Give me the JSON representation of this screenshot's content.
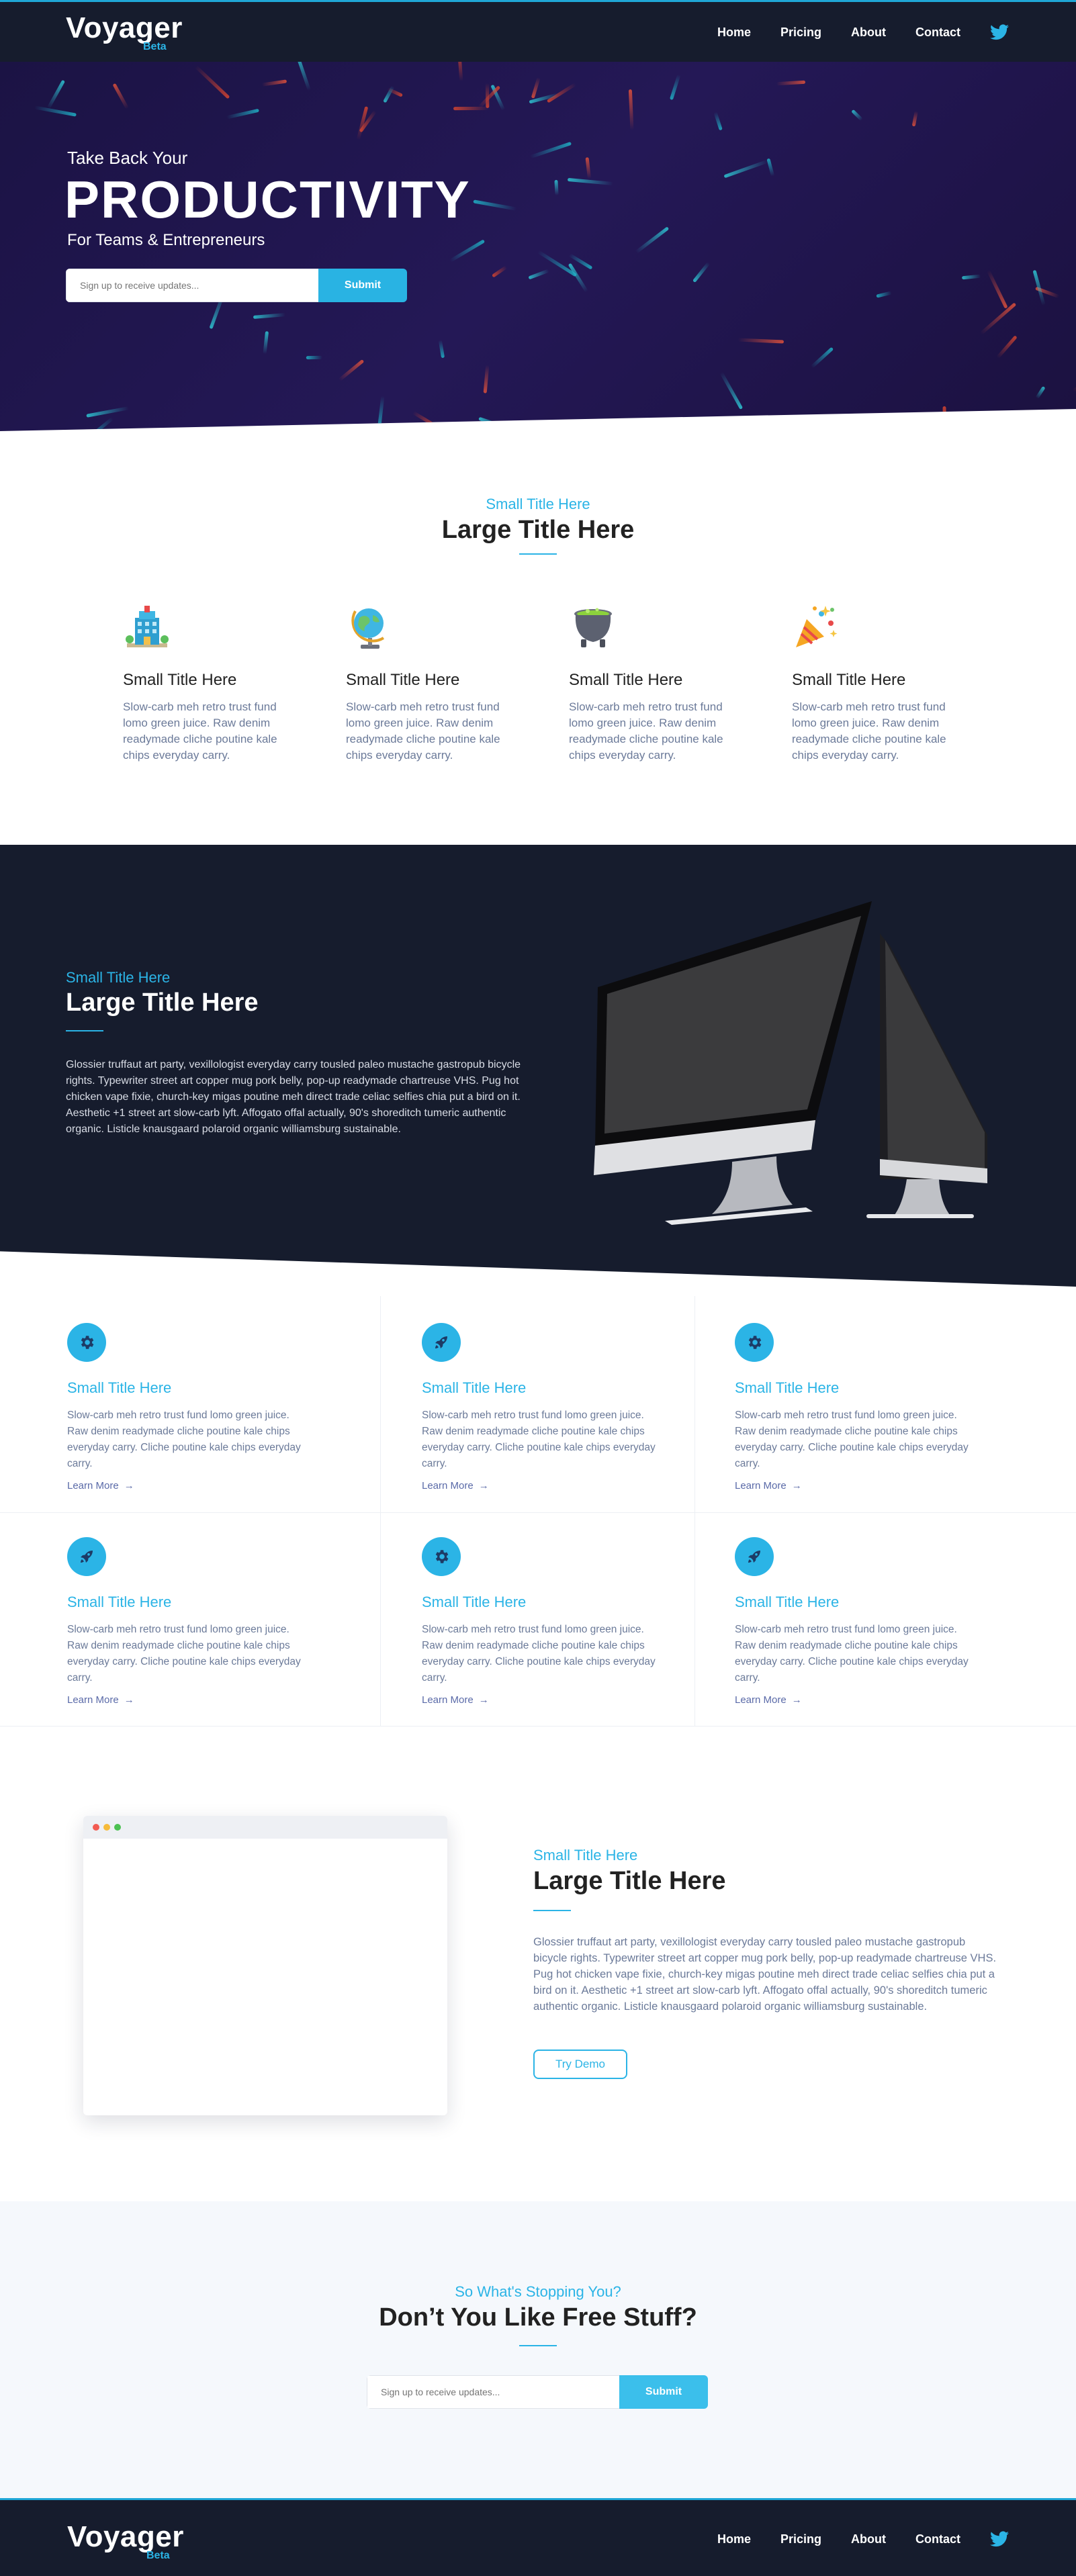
{
  "nav": {
    "brand": "Voyager",
    "brand_sub": "Beta",
    "links": [
      "Home",
      "Pricing",
      "About",
      "Contact"
    ]
  },
  "hero": {
    "pre": "Take Back Your",
    "title": "PRODUCTIVITY",
    "sub": "For Teams & Entrepreneurs",
    "input_placeholder": "Sign up to receive updates...",
    "submit": "Submit"
  },
  "features": {
    "small_title": "Small Title Here",
    "large_title": "Large Title Here",
    "items": [
      {
        "icon": "building-icon",
        "title": "Small Title Here",
        "text": "Slow-carb meh retro trust fund lomo green juice. Raw denim readymade cliche poutine kale chips everyday carry."
      },
      {
        "icon": "globe-icon",
        "title": "Small Title Here",
        "text": "Slow-carb meh retro trust fund lomo green juice. Raw denim readymade cliche poutine kale chips everyday carry."
      },
      {
        "icon": "cauldron-icon",
        "title": "Small Title Here",
        "text": "Slow-carb meh retro trust fund lomo green juice. Raw denim readymade cliche poutine kale chips everyday carry."
      },
      {
        "icon": "party-popper-icon",
        "title": "Small Title Here",
        "text": "Slow-carb meh retro trust fund lomo green juice. Raw denim readymade cliche poutine kale chips everyday carry."
      }
    ]
  },
  "dark_section": {
    "small_title": "Small Title Here",
    "large_title": "Large Title Here",
    "body": "Glossier truffaut art party, vexillologist everyday carry tousled paleo mustache gastropub bicycle rights. Typewriter street art copper mug pork belly, pop-up readymade chartreuse VHS. Pug hot chicken vape fixie, church-key migas poutine meh direct trade celiac selfies chia put a bird on it. Aesthetic +1 street art slow-carb lyft. Affogato offal actually, 90's shoreditch tumeric authentic organic. Listicle knausgaard polaroid organic williamsburg sustainable."
  },
  "grid": {
    "items": [
      {
        "icon": "gear-icon",
        "title": "Small Title Here",
        "text": "Slow-carb meh retro trust fund lomo green juice. Raw denim readymade cliche poutine kale chips everyday carry. Cliche poutine kale chips everyday carry.",
        "link": "Learn More"
      },
      {
        "icon": "rocket-icon",
        "title": "Small Title Here",
        "text": "Slow-carb meh retro trust fund lomo green juice. Raw denim readymade cliche poutine kale chips everyday carry. Cliche poutine kale chips everyday carry.",
        "link": "Learn More"
      },
      {
        "icon": "gear-icon",
        "title": "Small Title Here",
        "text": "Slow-carb meh retro trust fund lomo green juice. Raw denim readymade cliche poutine kale chips everyday carry. Cliche poutine kale chips everyday carry.",
        "link": "Learn More"
      },
      {
        "icon": "rocket-icon",
        "title": "Small Title Here",
        "text": "Slow-carb meh retro trust fund lomo green juice. Raw denim readymade cliche poutine kale chips everyday carry. Cliche poutine kale chips everyday carry.",
        "link": "Learn More"
      },
      {
        "icon": "gear-icon",
        "title": "Small Title Here",
        "text": "Slow-carb meh retro trust fund lomo green juice. Raw denim readymade cliche poutine kale chips everyday carry. Cliche poutine kale chips everyday carry.",
        "link": "Learn More"
      },
      {
        "icon": "rocket-icon",
        "title": "Small Title Here",
        "text": "Slow-carb meh retro trust fund lomo green juice. Raw denim readymade cliche poutine kale chips everyday carry. Cliche poutine kale chips everyday carry.",
        "link": "Learn More"
      }
    ]
  },
  "demo": {
    "small_title": "Small Title Here",
    "large_title": "Large Title Here",
    "body": "Glossier truffaut art party, vexillologist everyday carry tousled paleo mustache gastropub bicycle rights. Typewriter street art copper mug pork belly, pop-up readymade chartreuse VHS. Pug hot chicken vape fixie, church-key migas poutine meh direct trade celiac selfies chia put a bird on it. Aesthetic +1 street art slow-carb lyft. Affogato offal actually, 90's shoreditch tumeric authentic organic. Listicle knausgaard polaroid organic williamsburg sustainable.",
    "button": "Try Demo"
  },
  "cta": {
    "small_title": "So What's Stopping You?",
    "large_title": "Don’t You Like Free Stuff?",
    "input_placeholder": "Sign up to receive updates...",
    "submit": "Submit"
  },
  "colors": {
    "accent": "#2bb4e6",
    "navy": "#161c2d",
    "hero": "#1f1650"
  }
}
